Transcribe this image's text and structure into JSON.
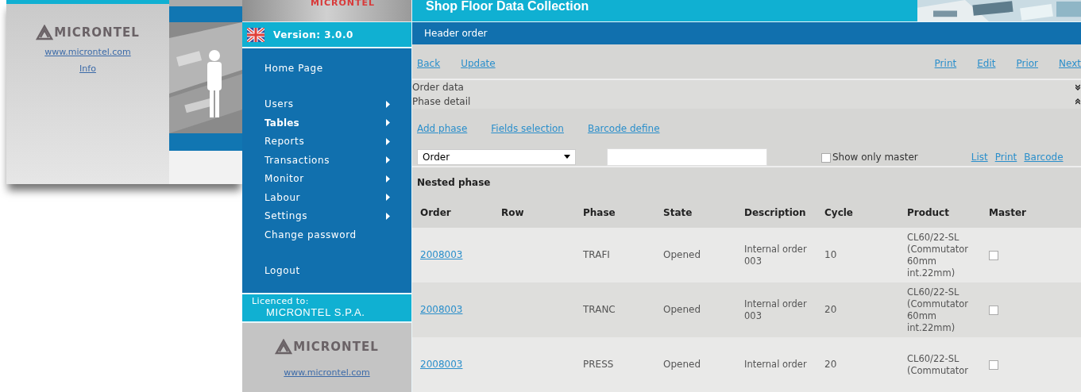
{
  "back_window": {
    "logo": "MICRONTEL",
    "links": [
      "www.microntel.com",
      "Info"
    ]
  },
  "sidebar": {
    "banner": "MICRONTEL",
    "version": "Version: 3.0.0",
    "menu": [
      [
        {
          "label": "Home Page",
          "submenu": false,
          "selected": false
        }
      ],
      [
        {
          "label": "Users",
          "submenu": true,
          "selected": false
        },
        {
          "label": "Tables",
          "submenu": true,
          "selected": true
        },
        {
          "label": "Reports",
          "submenu": true,
          "selected": false
        },
        {
          "label": "Transactions",
          "submenu": true,
          "selected": false
        },
        {
          "label": "Monitor",
          "submenu": true,
          "selected": false
        },
        {
          "label": "Labour",
          "submenu": true,
          "selected": false
        },
        {
          "label": "Settings",
          "submenu": true,
          "selected": false
        },
        {
          "label": "Change password",
          "submenu": false,
          "selected": false
        }
      ],
      [
        {
          "label": "Logout",
          "submenu": false,
          "selected": false
        }
      ]
    ],
    "licence_label": "Licenced to:",
    "licensee": "MICRONTEL S.P.A.",
    "logo": "MICRONTEL",
    "link": "www.microntel.com"
  },
  "window": {
    "title": "Shop Floor Data Collection"
  },
  "header": "Header order",
  "actions_left": [
    "Back",
    "Update"
  ],
  "actions_right": [
    "Print",
    "Edit",
    "Prior",
    "Next"
  ],
  "sections": [
    {
      "label": "Order data",
      "expanded": false
    },
    {
      "label": "Phase detail",
      "expanded": true
    }
  ],
  "phase_actions": [
    "Add phase",
    "Fields selection",
    "Barcode define"
  ],
  "filter": {
    "field": "Order",
    "show_only_master": {
      "label": "Show only master",
      "checked": false
    },
    "links": [
      "List",
      "Print",
      "Barcode"
    ]
  },
  "table": {
    "title": "Nested phase",
    "columns": [
      "Order",
      "Row",
      "Phase",
      "State",
      "Description",
      "Cycle",
      "Product",
      "Master"
    ],
    "rows": [
      {
        "order": "2008003",
        "phase": "TRAFI",
        "state": "Opened",
        "description": "Internal order 003",
        "cycle": "10",
        "product": "CL60/22-SL (Commutator 60mm int.22mm)",
        "master": false
      },
      {
        "order": "2008003",
        "phase": "TRANC",
        "state": "Opened",
        "description": "Internal order 003",
        "cycle": "20",
        "product": "CL60/22-SL (Commutator 60mm int.22mm)",
        "master": false
      },
      {
        "order": "2008003",
        "phase": "PRESS",
        "state": "Opened",
        "description": "Internal order",
        "cycle": "20",
        "product": "CL60/22-SL (Commutator",
        "master": false
      }
    ]
  }
}
